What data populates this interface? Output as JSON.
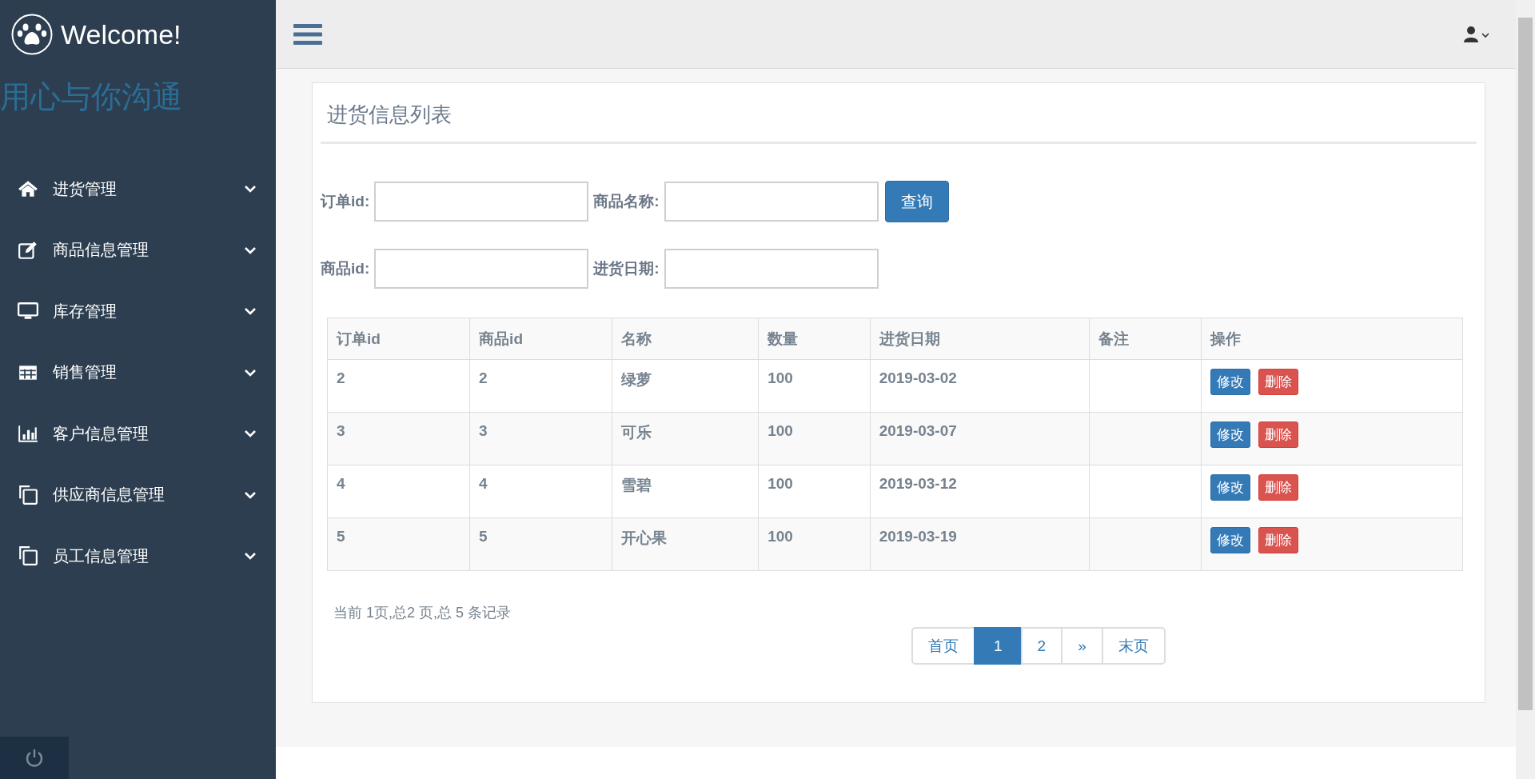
{
  "brand": {
    "title": "Welcome!",
    "slogan": "用心与你沟通"
  },
  "sidebar": {
    "items": [
      {
        "label": "进货管理",
        "expanded": false
      },
      {
        "label": "商品信息管理",
        "expanded": false
      },
      {
        "label": "库存管理",
        "expanded": false
      },
      {
        "label": "销售管理",
        "expanded": false
      },
      {
        "label": "客户信息管理",
        "expanded": false
      },
      {
        "label": "供应商信息管理",
        "expanded": false
      },
      {
        "label": "员工信息管理",
        "expanded": false
      }
    ]
  },
  "panel": {
    "title": "进货信息列表",
    "filters": [
      {
        "label": "订单id:"
      },
      {
        "label": "商品名称:"
      },
      {
        "label": "商品id:"
      },
      {
        "label": "进货日期:"
      }
    ],
    "search_button": "查询",
    "table": {
      "columns": [
        "订单id",
        "商品id",
        "名称",
        "数量",
        "进货日期",
        "备注",
        "操作"
      ],
      "rows": [
        {
          "cells": [
            "2",
            "2",
            "绿萝",
            "100",
            "2019-03-02",
            null
          ],
          "actions": [
            "修改",
            "删除"
          ]
        },
        {
          "cells": [
            "3",
            "3",
            "可乐",
            "100",
            "2019-03-07",
            null
          ],
          "actions": [
            "修改",
            "删除"
          ]
        },
        {
          "cells": [
            "4",
            "4",
            "雪碧",
            "100",
            "2019-03-12",
            null
          ],
          "actions": [
            "修改",
            "删除"
          ]
        },
        {
          "cells": [
            "5",
            "5",
            "开心果",
            "100",
            "2019-03-19",
            null
          ],
          "actions": [
            "修改",
            "删除"
          ]
        }
      ]
    },
    "summary": "当前 1页,总2 页,总 5 条记录",
    "pagination": [
      {
        "label": "首页",
        "selected": false
      },
      {
        "label": "1",
        "selected": true
      },
      {
        "label": "2",
        "selected": false
      },
      {
        "label": "»",
        "selected": false
      },
      {
        "label": "末页",
        "selected": false
      }
    ]
  }
}
